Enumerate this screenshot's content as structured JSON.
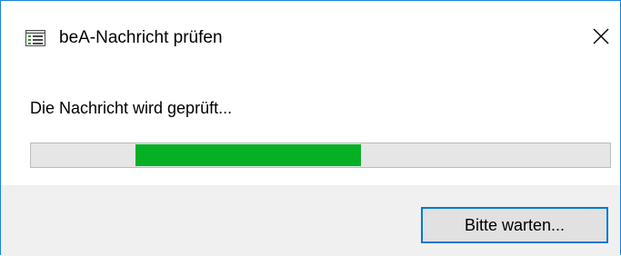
{
  "window": {
    "title": "beA-Nachricht prüfen",
    "app_icon": "list-window-icon",
    "close_icon": "close-icon"
  },
  "dialog": {
    "message": "Die Nachricht wird geprüft...",
    "progress": {
      "style": "marquee",
      "segment_start_fraction": 0.18,
      "segment_end_fraction": 0.57,
      "fill_color": "#06b025",
      "track_color": "#e6e6e6"
    },
    "wait_button_label": "Bitte warten..."
  },
  "colors": {
    "window_border": "#1883d7",
    "footer_background": "#f0f0f0",
    "button_focus_border": "#0078d7"
  }
}
